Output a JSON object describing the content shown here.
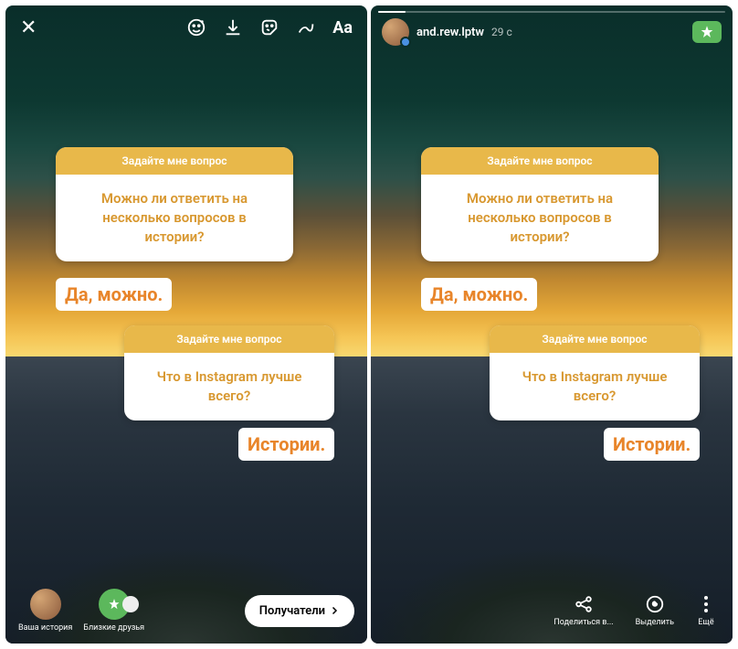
{
  "editor": {
    "toolbar": {
      "close": "✕",
      "text_tool": "Aa"
    },
    "q1": {
      "header": "Задайте мне вопрос",
      "body": "Можно ли ответить на несколько вопросов в истории?"
    },
    "a1": "Да, можно.",
    "q2": {
      "header": "Задайте мне вопрос",
      "body": "Что в Instagram лучше всего?"
    },
    "a2": "Истории.",
    "bottom": {
      "your_story": "Ваша история",
      "close_friends": "Близкие друзья",
      "recipients": "Получатели"
    }
  },
  "viewer": {
    "username": "and.rew.lptw",
    "timestamp": "29 с",
    "q1": {
      "header": "Задайте мне вопрос",
      "body": "Можно ли ответить на несколько вопросов в истории?"
    },
    "a1": "Да, можно.",
    "q2": {
      "header": "Задайте мне вопрос",
      "body": "Что в Instagram лучше всего?"
    },
    "a2": "Истории.",
    "actions": {
      "share": "Поделиться в...",
      "highlight": "Выделить",
      "more": "Ещё"
    }
  }
}
